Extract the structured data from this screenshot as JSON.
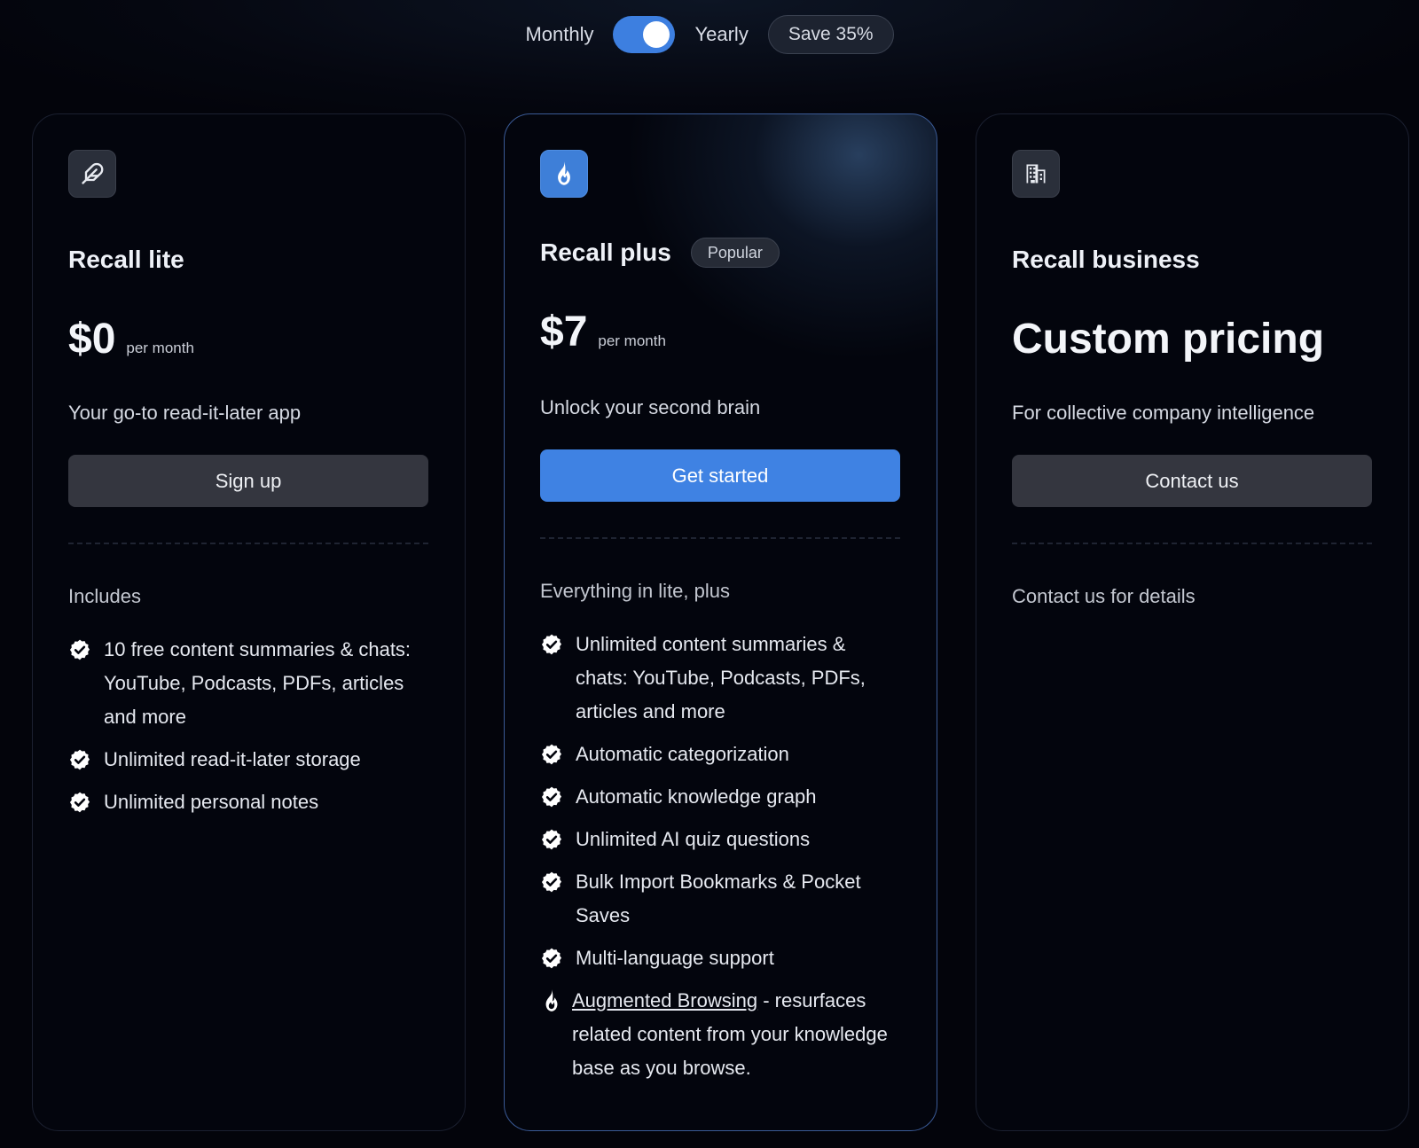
{
  "billing": {
    "monthly_label": "Monthly",
    "yearly_label": "Yearly",
    "save_badge": "Save 35%",
    "toggle_state": "yearly"
  },
  "colors": {
    "accent": "#3f82e3",
    "background": "#03040b",
    "secondary_button": "#34363f"
  },
  "plans": [
    {
      "icon": "feather-icon",
      "name": "Recall lite",
      "price": "$0",
      "per": "per month",
      "tagline": "Your go-to read-it-later app",
      "cta": "Sign up",
      "section_title": "Includes",
      "features": [
        "10 free content summaries & chats: YouTube, Podcasts, PDFs, articles and more",
        "Unlimited read-it-later storage",
        "Unlimited personal notes"
      ]
    },
    {
      "icon": "flame-icon",
      "name": "Recall plus",
      "badge": "Popular",
      "price": "$7",
      "per": "per month",
      "tagline": "Unlock your second brain",
      "cta": "Get started",
      "section_title": "Everything in lite, plus",
      "features": [
        "Unlimited content summaries & chats: YouTube, Podcasts, PDFs, articles and more",
        "Automatic categorization",
        "Automatic knowledge graph",
        "Unlimited AI quiz questions",
        "Bulk Import Bookmarks & Pocket Saves",
        "Multi-language support"
      ],
      "special_feature": {
        "link": "Augmented Browsing",
        "text": " - resurfaces related content from your knowledge base as you browse."
      }
    },
    {
      "icon": "building-icon",
      "name": "Recall business",
      "price": "Custom pricing",
      "tagline": "For collective company intelligence",
      "cta": "Contact us",
      "section_title": "Contact us for details"
    }
  ]
}
